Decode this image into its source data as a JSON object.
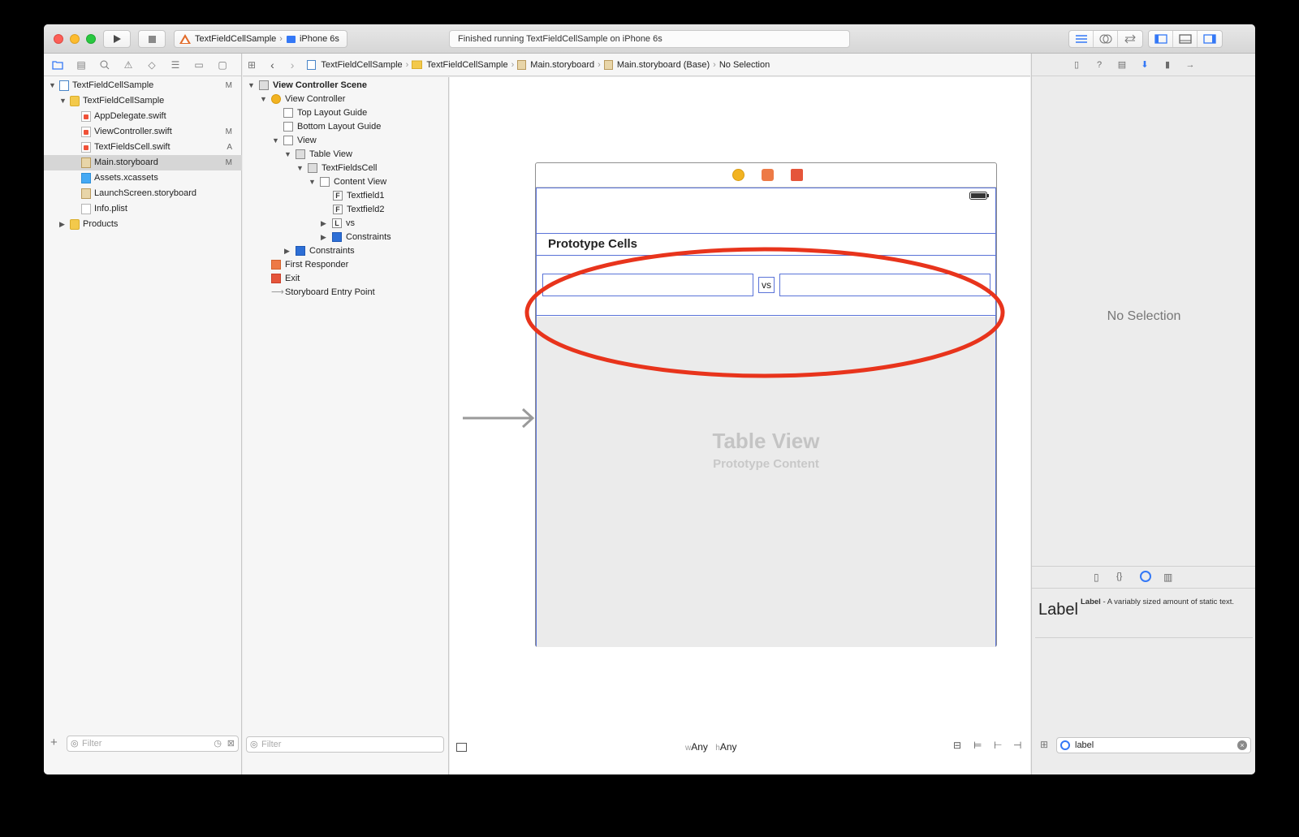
{
  "toolbar": {
    "scheme_target": "TextFieldCellSample",
    "device": "iPhone 6s",
    "status": "Finished running TextFieldCellSample on iPhone 6s"
  },
  "navigator": {
    "rows": [
      {
        "label": "TextFieldCellSample",
        "badge": "M"
      },
      {
        "label": "TextFieldCellSample",
        "badge": ""
      },
      {
        "label": "AppDelegate.swift",
        "badge": ""
      },
      {
        "label": "ViewController.swift",
        "badge": "M"
      },
      {
        "label": "TextFieldsCell.swift",
        "badge": "A"
      },
      {
        "label": "Main.storyboard",
        "badge": "M"
      },
      {
        "label": "Assets.xcassets",
        "badge": ""
      },
      {
        "label": "LaunchScreen.storyboard",
        "badge": ""
      },
      {
        "label": "Info.plist",
        "badge": ""
      },
      {
        "label": "Products",
        "badge": ""
      }
    ],
    "filter_placeholder": "Filter"
  },
  "jumpbar": {
    "crumbs": [
      "TextFieldCellSample",
      "TextFieldCellSample",
      "Main.storyboard",
      "Main.storyboard (Base)",
      "No Selection"
    ]
  },
  "outline": {
    "rows": [
      {
        "label": "View Controller Scene",
        "icon": ""
      },
      {
        "label": "View Controller",
        "icon": ""
      },
      {
        "label": "Top Layout Guide",
        "icon": ""
      },
      {
        "label": "Bottom Layout Guide",
        "icon": ""
      },
      {
        "label": "View",
        "icon": ""
      },
      {
        "label": "Table View",
        "icon": ""
      },
      {
        "label": "TextFieldsCell",
        "icon": ""
      },
      {
        "label": "Content View",
        "icon": ""
      },
      {
        "label": "Textfield1",
        "icon": "F"
      },
      {
        "label": "Textfield2",
        "icon": "F"
      },
      {
        "label": "vs",
        "icon": "L"
      },
      {
        "label": "Constraints",
        "icon": ""
      },
      {
        "label": "Constraints",
        "icon": ""
      },
      {
        "label": "First Responder",
        "icon": ""
      },
      {
        "label": "Exit",
        "icon": ""
      },
      {
        "label": "Storyboard Entry Point",
        "icon": ""
      }
    ],
    "filter_placeholder": "Filter"
  },
  "canvas": {
    "prototype_cells": "Prototype Cells",
    "vs_label": "vs",
    "table_view_title": "Table View",
    "table_view_subtitle": "Prototype Content",
    "size_class_w_prefix": "w",
    "size_class_w": "Any",
    "size_class_h_prefix": "h",
    "size_class_h": "Any"
  },
  "annotation": {
    "color": "#e8341c"
  },
  "inspector": {
    "no_selection": "No Selection",
    "library_item_big": "Label",
    "library_item_title": "Label",
    "library_item_desc": " - A variably sized amount of static text.",
    "search_value": "label"
  },
  "colors": {
    "accent": "#3478f6",
    "selection_blue": "#5a73d8"
  }
}
